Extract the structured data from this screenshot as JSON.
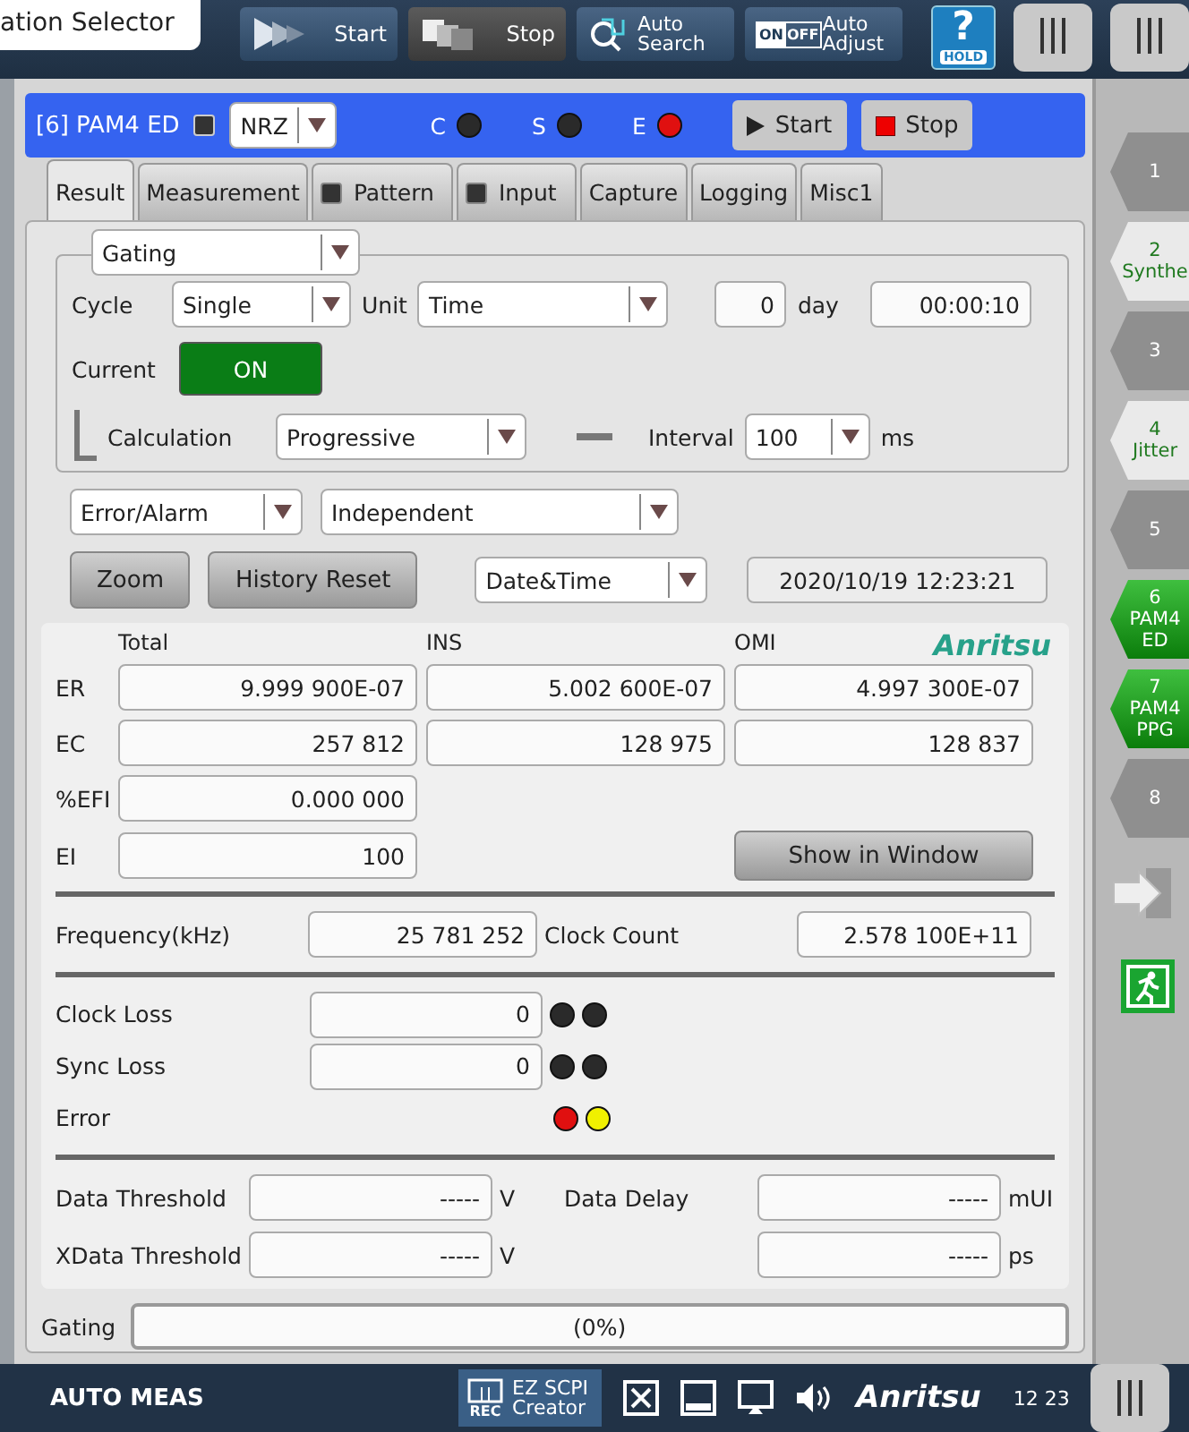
{
  "top_bar": {
    "selector_title": "ation Selector",
    "buttons": [
      {
        "kind": "start",
        "label": "Start"
      },
      {
        "kind": "stop",
        "label": "Stop"
      },
      {
        "kind": "search",
        "label": "Auto Search"
      },
      {
        "kind": "adjust",
        "label": "Auto Adjust",
        "icon_on": "ON",
        "icon_off": "OFF"
      }
    ],
    "help_symbol": "?",
    "help_label": "HOLD"
  },
  "module_bar": {
    "title": "[6] PAM4 ED",
    "mode": "NRZ",
    "leds": [
      {
        "label": "C",
        "color": "#2a2a2a"
      },
      {
        "label": "S",
        "color": "#2a2a2a"
      },
      {
        "label": "E",
        "color": "#e01010"
      }
    ],
    "buttons": [
      {
        "kind": "start",
        "label": "Start"
      },
      {
        "kind": "stop",
        "label": "Stop"
      }
    ]
  },
  "tabs": [
    {
      "label": "Result",
      "selected": true,
      "badge": false
    },
    {
      "label": "Measurement",
      "selected": false,
      "badge": false
    },
    {
      "label": "Pattern",
      "selected": false,
      "badge": true
    },
    {
      "label": "Input",
      "selected": false,
      "badge": true
    },
    {
      "label": "Capture",
      "selected": false,
      "badge": false
    },
    {
      "label": "Logging",
      "selected": false,
      "badge": false
    },
    {
      "label": "Misc1",
      "selected": false,
      "badge": false
    }
  ],
  "gating": {
    "mode": "Gating",
    "cycle_label": "Cycle",
    "cycle": "Single",
    "unit_label": "Unit",
    "unit": "Time",
    "days": "0",
    "day_label": "day",
    "time": "00:00:10",
    "current_label": "Current",
    "current": {
      "label": "ON",
      "on": true
    },
    "calculation_label": "Calculation",
    "calculation": "Progressive",
    "interval_label": "Interval",
    "interval": "100",
    "interval_unit": "ms"
  },
  "display": {
    "category": "Error/Alarm",
    "option": "Independent",
    "buttons": [
      "Zoom",
      "History Reset"
    ],
    "time_mode": "Date&Time",
    "timestamp": "2020/10/19 12:23:21"
  },
  "results": {
    "columns": [
      "Total",
      "INS",
      "OMI"
    ],
    "logo": "Anritsu",
    "rows": [
      {
        "label": "ER",
        "values": [
          "9.999 900E-07",
          "5.002 600E-07",
          "4.997 300E-07"
        ]
      },
      {
        "label": "EC",
        "values": [
          "257 812",
          "128 975",
          "128 837"
        ]
      },
      {
        "label": "%EFI",
        "values": [
          "0.000 000"
        ]
      },
      {
        "label": "EI",
        "values": [
          "100"
        ]
      }
    ],
    "show_button": "Show in Window",
    "frequency_label": "Frequency(kHz)",
    "frequency": "25 781 252",
    "clock_count_label": "Clock Count",
    "clock_count": "2.578 100E+11",
    "alarms": [
      {
        "label": "Clock Loss",
        "value": "0",
        "leds": [
          {
            "color": "#2a2a2a"
          },
          {
            "color": "#2a2a2a"
          }
        ]
      },
      {
        "label": "Sync Loss",
        "value": "0",
        "leds": [
          {
            "color": "#2a2a2a"
          },
          {
            "color": "#2a2a2a"
          }
        ]
      },
      {
        "label": "Error",
        "leds": [
          {
            "color": "#e01010"
          },
          {
            "color": "#f0f000"
          }
        ]
      }
    ],
    "thresholds": [
      {
        "label": "Data Threshold",
        "value": "-----",
        "unit": "V"
      },
      {
        "label": "Data Delay",
        "value": "-----",
        "unit": "mUI"
      },
      {
        "label": "XData Threshold",
        "value": "-----",
        "unit": "V"
      },
      {
        "value": "-----",
        "unit": "ps"
      }
    ]
  },
  "progress": {
    "label": "Gating",
    "level": 0,
    "text": "(0%)"
  },
  "sidebar": {
    "slots": [
      {
        "number": "1",
        "kind": "empty"
      },
      {
        "number": "2",
        "name": "Synthe",
        "kind": "available"
      },
      {
        "number": "3",
        "kind": "empty"
      },
      {
        "number": "4",
        "name": "Jitter",
        "kind": "available"
      },
      {
        "number": "5",
        "kind": "empty"
      },
      {
        "number": "6",
        "name": "PAM4 ED",
        "kind": "active"
      },
      {
        "number": "7",
        "name": "PAM4 PPG",
        "kind": "active"
      },
      {
        "number": "8",
        "kind": "empty"
      }
    ]
  },
  "taskbar": {
    "mode": "AUTO MEAS",
    "scpi_button": "EZ SCPI Creator",
    "rec_label": "REC",
    "logo": "Anritsu",
    "time": "12 23"
  }
}
